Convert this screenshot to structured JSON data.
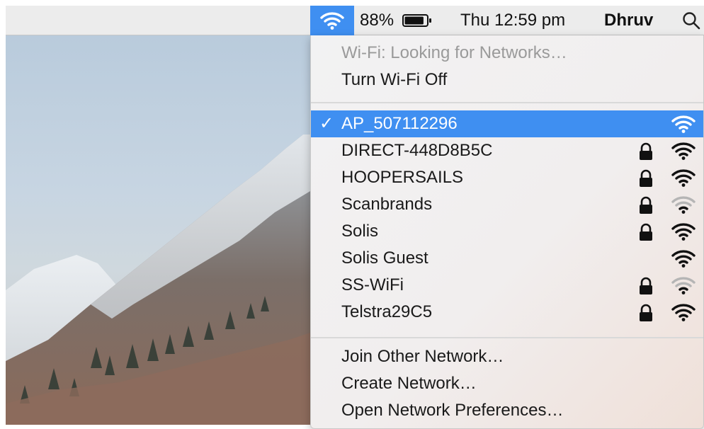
{
  "menubar": {
    "battery_percent": "88%",
    "battery_level": 0.88,
    "clock": "Thu 12:59 pm",
    "user": "Dhruv",
    "accent_color": "#3f8ff1"
  },
  "wifi_menu": {
    "status": "Wi-Fi: Looking for Networks…",
    "toggle_label": "Turn Wi-Fi Off",
    "networks": [
      {
        "name": "AP_507112296",
        "locked": false,
        "selected": true,
        "signal": 3
      },
      {
        "name": "DIRECT-448D8B5C",
        "locked": true,
        "selected": false,
        "signal": 3
      },
      {
        "name": "HOOPERSAILS",
        "locked": true,
        "selected": false,
        "signal": 3
      },
      {
        "name": "Scanbrands",
        "locked": true,
        "selected": false,
        "signal": 1
      },
      {
        "name": "Solis",
        "locked": true,
        "selected": false,
        "signal": 3
      },
      {
        "name": "Solis Guest",
        "locked": false,
        "selected": false,
        "signal": 3
      },
      {
        "name": "SS-WiFi",
        "locked": true,
        "selected": false,
        "signal": 1
      },
      {
        "name": "Telstra29C5",
        "locked": true,
        "selected": false,
        "signal": 3
      }
    ],
    "actions": {
      "join_other": "Join Other Network…",
      "create": "Create Network…",
      "preferences": "Open Network Preferences…"
    },
    "check_glyph": "✓"
  }
}
